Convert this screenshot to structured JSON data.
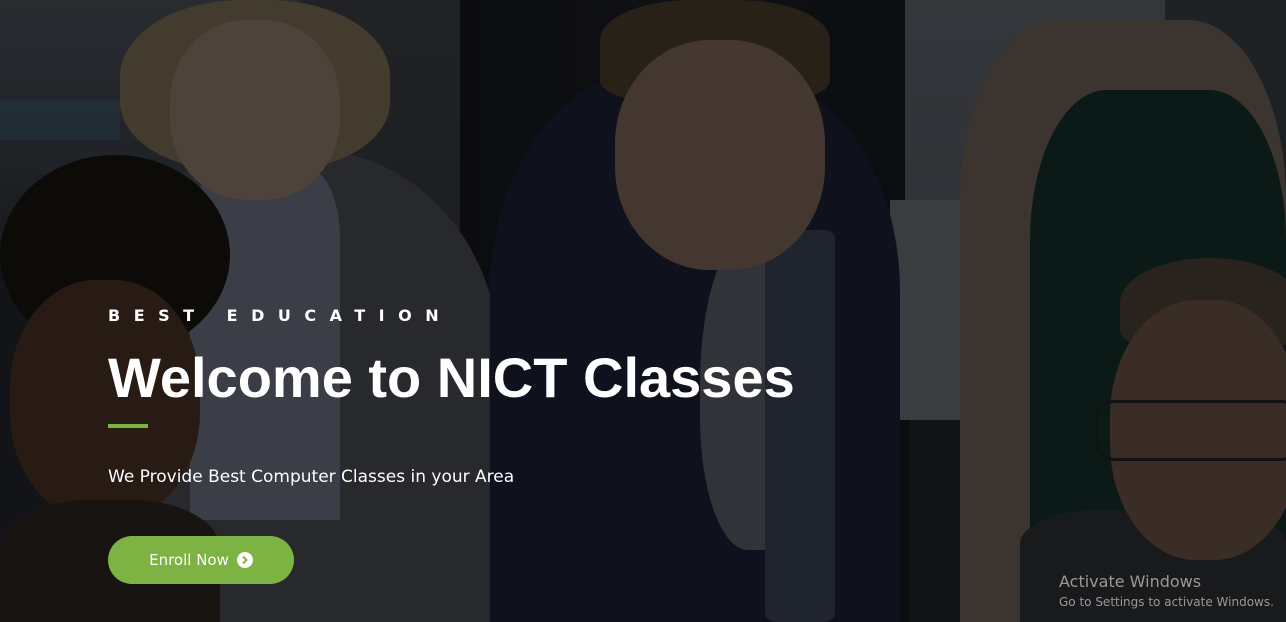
{
  "hero": {
    "eyebrow": "BEST EDUCATION",
    "title": "Welcome to NICT Classes",
    "subtitle": "We Provide Best Computer Classes in your Area",
    "cta": {
      "label": "Enroll Now",
      "icon": "chevron-right-circle-icon"
    },
    "background_image": "group of people gathered around a laptop",
    "accent_color": "#7cb342",
    "text_color": "#ffffff"
  },
  "os_watermark": {
    "title": "Activate Windows",
    "subtitle": "Go to Settings to activate Windows."
  }
}
